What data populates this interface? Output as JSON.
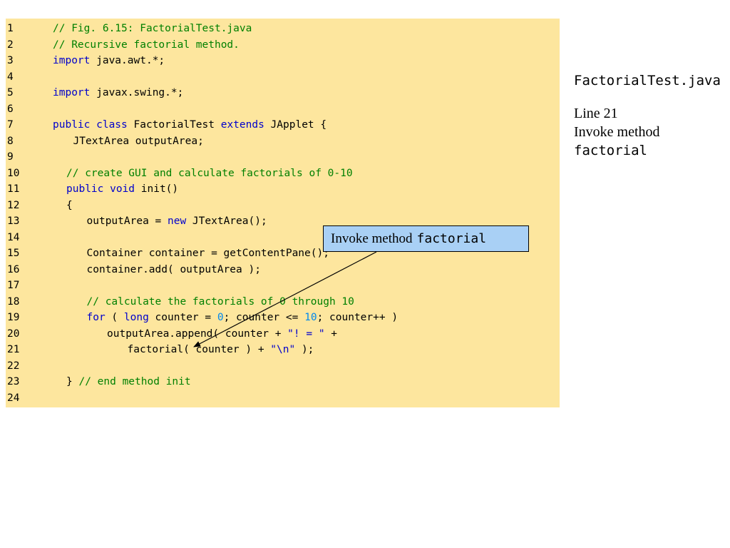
{
  "code": {
    "lines": [
      {
        "num": "1",
        "indent": 0,
        "tokens": [
          {
            "t": "// Fig. 6.15: FactorialTest.java",
            "k": "comment"
          }
        ]
      },
      {
        "num": "2",
        "indent": 0,
        "tokens": [
          {
            "t": "// Recursive factorial method.",
            "k": "comment"
          }
        ]
      },
      {
        "num": "3",
        "indent": 0,
        "tokens": [
          {
            "t": "import",
            "k": "keyword"
          },
          {
            "t": " java.awt.*;",
            "k": "plain"
          }
        ]
      },
      {
        "num": "4",
        "indent": 0,
        "tokens": []
      },
      {
        "num": "5",
        "indent": 0,
        "tokens": [
          {
            "t": "import",
            "k": "keyword"
          },
          {
            "t": " javax.swing.*;",
            "k": "plain"
          }
        ]
      },
      {
        "num": "6",
        "indent": 0,
        "tokens": []
      },
      {
        "num": "7",
        "indent": 0,
        "tokens": [
          {
            "t": "public class",
            "k": "keyword"
          },
          {
            "t": " FactorialTest ",
            "k": "plain"
          },
          {
            "t": "extends",
            "k": "keyword"
          },
          {
            "t": " JApplet {",
            "k": "plain"
          }
        ]
      },
      {
        "num": "8",
        "indent": 3,
        "tokens": [
          {
            "t": "JTextArea outputArea;",
            "k": "plain"
          }
        ]
      },
      {
        "num": "9",
        "indent": 0,
        "tokens": []
      },
      {
        "num": "10",
        "indent": 2,
        "tokens": [
          {
            "t": "// create GUI and calculate factorials of 0-10",
            "k": "comment"
          }
        ]
      },
      {
        "num": "11",
        "indent": 2,
        "tokens": [
          {
            "t": "public void",
            "k": "keyword"
          },
          {
            "t": " init()",
            "k": "plain"
          }
        ]
      },
      {
        "num": "12",
        "indent": 2,
        "tokens": [
          {
            "t": "{",
            "k": "plain"
          }
        ]
      },
      {
        "num": "13",
        "indent": 5,
        "tokens": [
          {
            "t": "outputArea = ",
            "k": "plain"
          },
          {
            "t": "new",
            "k": "keyword"
          },
          {
            "t": " JTextArea();",
            "k": "plain"
          }
        ]
      },
      {
        "num": "14",
        "indent": 0,
        "tokens": []
      },
      {
        "num": "15",
        "indent": 5,
        "tokens": [
          {
            "t": "Container container = getContentPane();",
            "k": "plain"
          }
        ]
      },
      {
        "num": "16",
        "indent": 5,
        "tokens": [
          {
            "t": "container.add( outputArea );",
            "k": "plain"
          }
        ]
      },
      {
        "num": "17",
        "indent": 0,
        "tokens": []
      },
      {
        "num": "18",
        "indent": 5,
        "tokens": [
          {
            "t": "// calculate the factorials of 0 through 10",
            "k": "comment"
          }
        ]
      },
      {
        "num": "19",
        "indent": 5,
        "tokens": [
          {
            "t": "for",
            "k": "keyword"
          },
          {
            "t": " ( ",
            "k": "plain"
          },
          {
            "t": "long",
            "k": "keyword"
          },
          {
            "t": " counter = ",
            "k": "plain"
          },
          {
            "t": "0",
            "k": "number"
          },
          {
            "t": "; counter <= ",
            "k": "plain"
          },
          {
            "t": "10",
            "k": "number"
          },
          {
            "t": "; counter++ )",
            "k": "plain"
          }
        ]
      },
      {
        "num": "20",
        "indent": 8,
        "tokens": [
          {
            "t": "outputArea.append( counter + ",
            "k": "plain"
          },
          {
            "t": "\"! = \"",
            "k": "string"
          },
          {
            "t": " +",
            "k": "plain"
          }
        ]
      },
      {
        "num": "21",
        "indent": 11,
        "tokens": [
          {
            "t": "factorial( counter ) + ",
            "k": "plain"
          },
          {
            "t": "\"\\n\"",
            "k": "string"
          },
          {
            "t": " );",
            "k": "plain"
          }
        ]
      },
      {
        "num": "22",
        "indent": 0,
        "tokens": []
      },
      {
        "num": "23",
        "indent": 2,
        "tokens": [
          {
            "t": "} ",
            "k": "plain"
          },
          {
            "t": "// end method init",
            "k": "comment"
          }
        ]
      },
      {
        "num": "24",
        "indent": 0,
        "tokens": []
      }
    ]
  },
  "callout": {
    "prefix": "Invoke method",
    "code": "factorial"
  },
  "side": {
    "file": "FactorialTest.java",
    "line_label": "Line 21",
    "invoke_label": "Invoke method",
    "invoke_code": "factorial"
  },
  "colors": {
    "panel_bg": "#fde69e",
    "comment": "#008000",
    "keyword": "#0000cc",
    "number": "#0088ee",
    "callout_bg": "#a9d0f5"
  }
}
